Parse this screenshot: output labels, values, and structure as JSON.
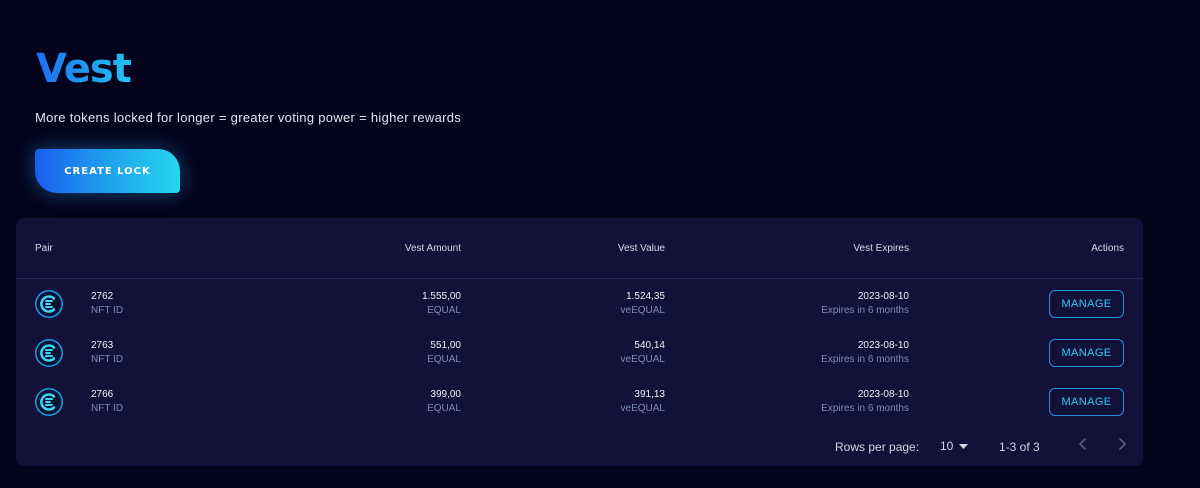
{
  "header": {
    "title": "Vest",
    "subtitle": "More tokens locked for longer = greater voting power = higher rewards",
    "create_label": "CREATE LOCK"
  },
  "table": {
    "columns": {
      "pair": "Pair",
      "amount": "Vest Amount",
      "value": "Vest Value",
      "expires": "Vest Expires",
      "actions": "Actions"
    },
    "rows": [
      {
        "nft": "2762",
        "nft_label": "NFT ID",
        "amount": "1.555,00",
        "amount_unit": "EQUAL",
        "value": "1.524,35",
        "value_unit": "veEQUAL",
        "expires": "2023-08-10",
        "expires_note": "Expires in 6 months",
        "action": "MANAGE"
      },
      {
        "nft": "2763",
        "nft_label": "NFT ID",
        "amount": "551,00",
        "amount_unit": "EQUAL",
        "value": "540,14",
        "value_unit": "veEQUAL",
        "expires": "2023-08-10",
        "expires_note": "Expires in 6 months",
        "action": "MANAGE"
      },
      {
        "nft": "2766",
        "nft_label": "NFT ID",
        "amount": "399,00",
        "amount_unit": "EQUAL",
        "value": "391,13",
        "value_unit": "veEQUAL",
        "expires": "2023-08-10",
        "expires_note": "Expires in 6 months",
        "action": "MANAGE"
      }
    ]
  },
  "pagination": {
    "rows_label": "Rows per page:",
    "rows_value": "10",
    "range": "1-3 of 3",
    "prev_icon": "chevron-left-icon",
    "next_icon": "chevron-right-icon"
  },
  "colors": {
    "background": "#03031b",
    "panel": "#11113a",
    "accent_blue": "#1d6df2",
    "accent_cyan": "#22c4f0"
  }
}
